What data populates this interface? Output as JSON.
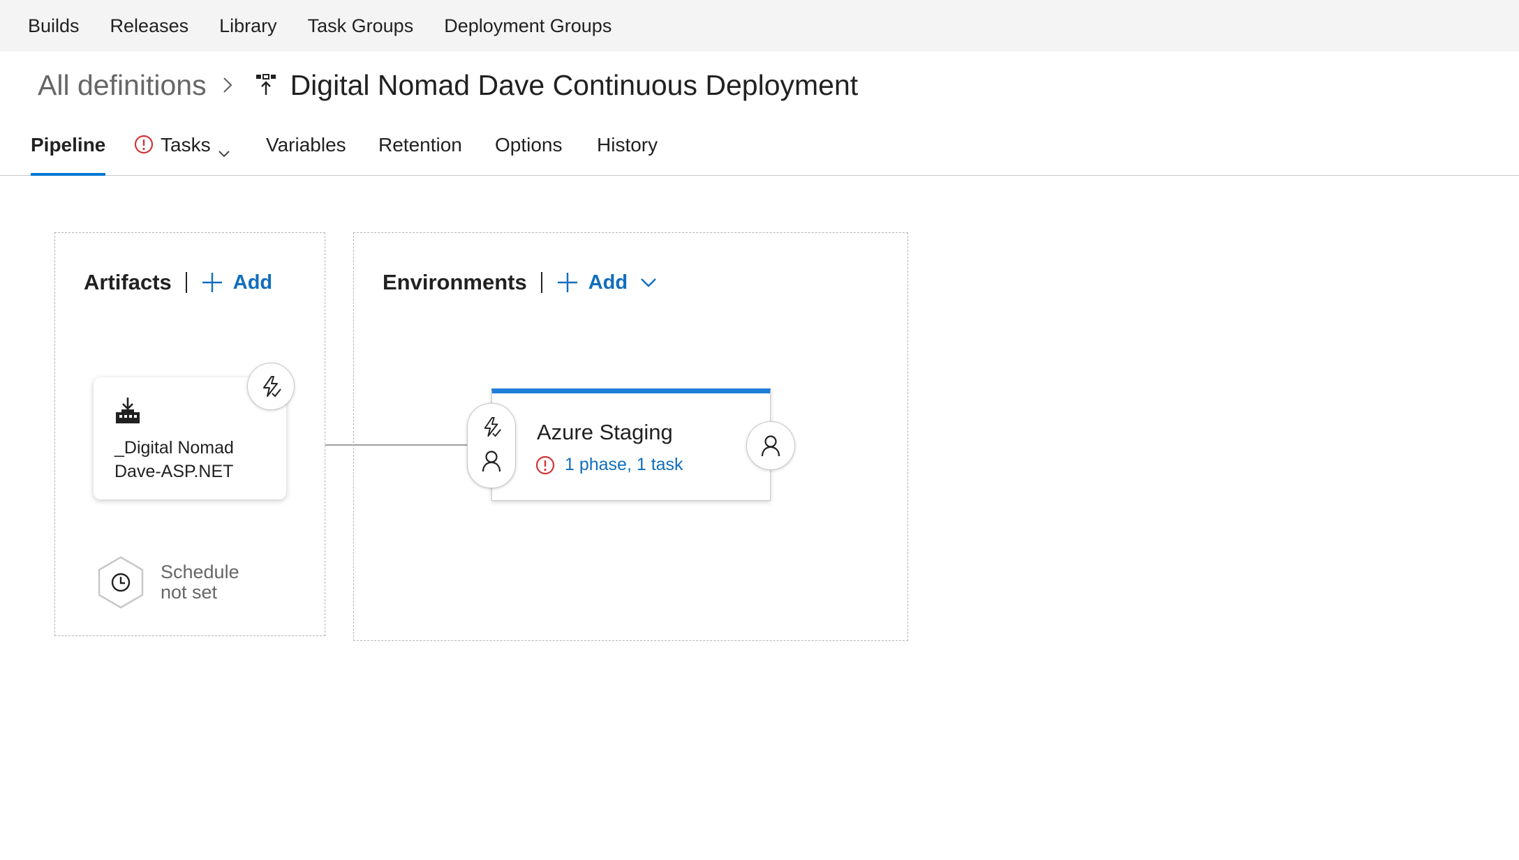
{
  "topnav": {
    "items": [
      "Builds",
      "Releases",
      "Library",
      "Task Groups",
      "Deployment Groups"
    ]
  },
  "breadcrumb": {
    "all_definitions": "All definitions",
    "definition_title": "Digital Nomad Dave Continuous Deployment"
  },
  "tabs": {
    "pipeline": "Pipeline",
    "tasks": "Tasks",
    "variables": "Variables",
    "retention": "Retention",
    "options": "Options",
    "history": "History"
  },
  "artifacts": {
    "title": "Artifacts",
    "add_label": "Add",
    "artifact_line1": "_Digital Nomad",
    "artifact_line2": "Dave-ASP.NET",
    "schedule_line1": "Schedule",
    "schedule_line2": "not set"
  },
  "environments": {
    "title": "Environments",
    "add_label": "Add",
    "env_name": "Azure Staging",
    "env_status": "1 phase, 1 task"
  },
  "colors": {
    "accent": "#0078d4",
    "link": "#106ebe",
    "error": "#d13438",
    "env_bar": "#1e7fd8"
  },
  "icons": {
    "release": "release-pipeline-icon",
    "breadcrumb_sep": "chevron-right-icon",
    "warning": "error-circle-icon",
    "add": "plus-icon",
    "trigger": "lightning-icon",
    "approver": "person-icon",
    "artifact": "build-artifact-icon",
    "schedule": "clock-icon"
  }
}
